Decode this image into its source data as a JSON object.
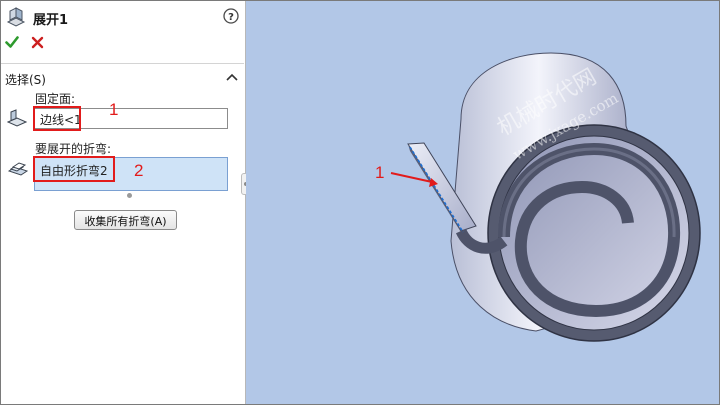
{
  "panel": {
    "title": "展开1",
    "section_title": "选择(S)",
    "fixed_face_label": "固定面:",
    "fixed_face_value": "边线<1",
    "bends_label": "要展开的折弯:",
    "bends_value": "自由形折弯2",
    "collect_button_label": "收集所有折弯(A)"
  },
  "annotations": {
    "marker_1": "1",
    "marker_2": "2",
    "viewport_marker": "1"
  },
  "watermark": {
    "line1": "机械时代网",
    "line2": "www.jxage.com"
  },
  "colors": {
    "annotation_red": "#e21b1b",
    "ok_green": "#2d9a2d",
    "cancel_red": "#cc1f1f",
    "viewport_bg": "#b2c7e7",
    "selected_field_bg": "#cfe3f7"
  },
  "icons": [
    "feature-unfold-icon",
    "help-icon",
    "ok-checkmark-icon",
    "cancel-x-icon",
    "collapse-chevron-icon",
    "fixed-face-icon",
    "bends-icon"
  ]
}
